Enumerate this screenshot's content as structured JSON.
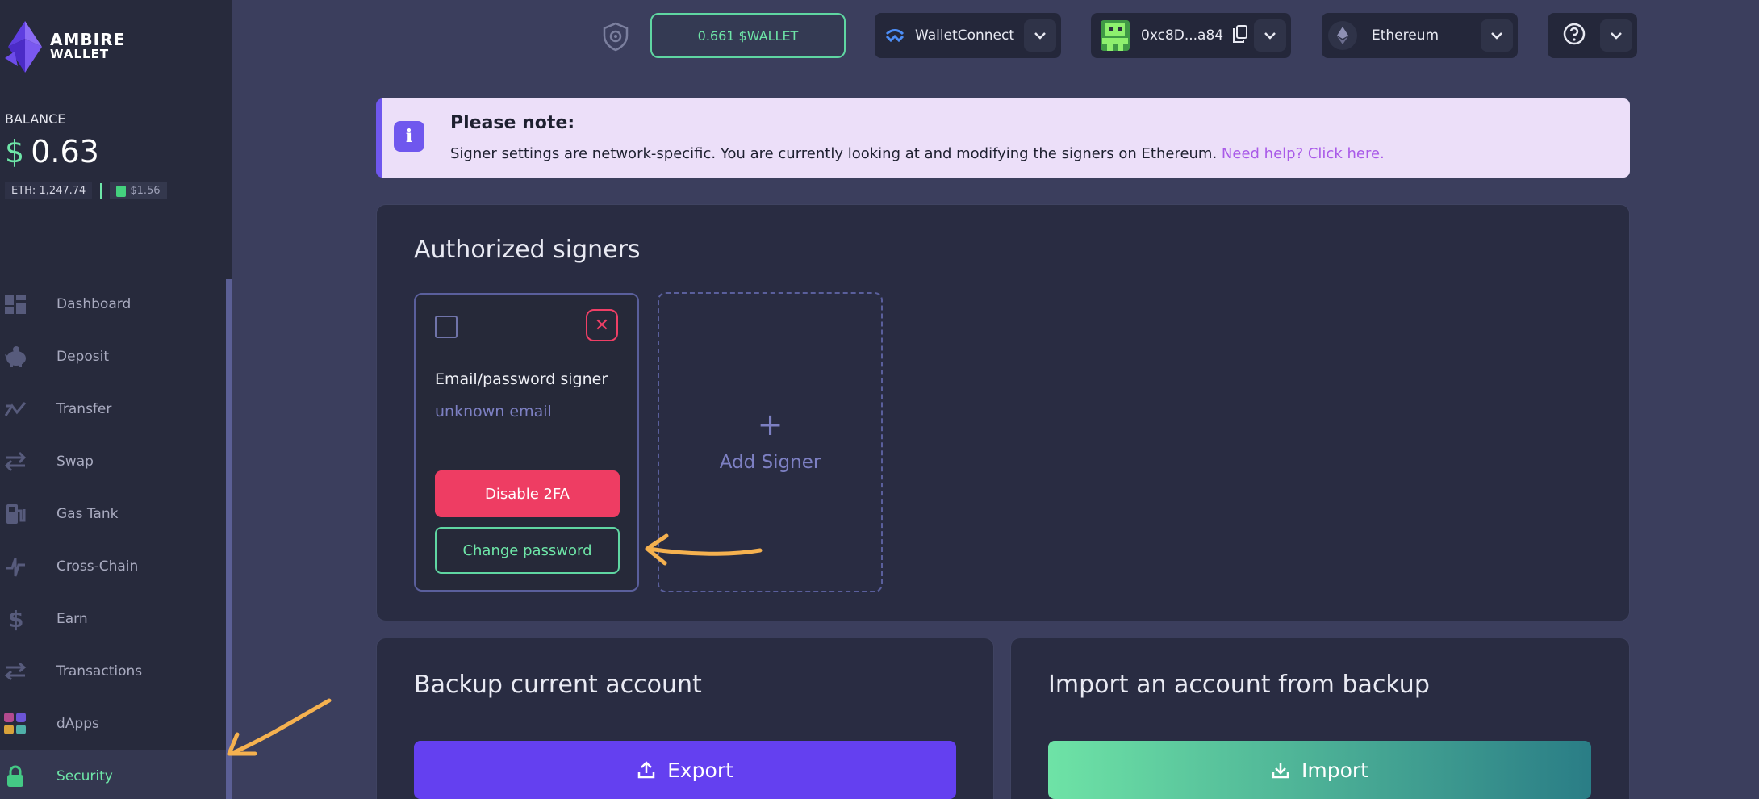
{
  "sidebar": {
    "logo": {
      "line1": "AMBIRE",
      "line2": "WALLET"
    },
    "balance_label": "BALANCE",
    "balance_currency": "$",
    "balance_value": "0.63",
    "eth_chip": "ETH: 1,247.74",
    "gas_chip": "$1.56",
    "items": [
      {
        "label": "Dashboard",
        "icon": "dashboard-icon"
      },
      {
        "label": "Deposit",
        "icon": "piggy-bank-icon"
      },
      {
        "label": "Transfer",
        "icon": "transfer-icon"
      },
      {
        "label": "Swap",
        "icon": "swap-icon"
      },
      {
        "label": "Gas Tank",
        "icon": "gas-pump-icon"
      },
      {
        "label": "Cross-Chain",
        "icon": "cross-chain-icon"
      },
      {
        "label": "Earn",
        "icon": "dollar-icon"
      },
      {
        "label": "Transactions",
        "icon": "transactions-icon"
      },
      {
        "label": "dApps",
        "icon": "apps-grid-icon"
      },
      {
        "label": "Security",
        "icon": "lock-icon",
        "active": true
      }
    ]
  },
  "topbar": {
    "wallet_token": "0.661 $WALLET",
    "walletconnect_label": "WalletConnect",
    "account_address": "0xc8D...a84",
    "network_label": "Ethereum",
    "help_icon": "help-circle-icon"
  },
  "notice": {
    "title": "Please note:",
    "text": "Signer settings are network-specific. You are currently looking at and modifying the signers on Ethereum.",
    "link": "Need help? Click here."
  },
  "signers": {
    "title": "Authorized signers",
    "card": {
      "type": "Email/password signer",
      "email": "unknown email",
      "disable_label": "Disable 2FA",
      "change_label": "Change password"
    },
    "add_label": "Add Signer",
    "add_symbol": "+"
  },
  "backup": {
    "title": "Backup current account",
    "export_label": "Export"
  },
  "import_backup": {
    "title": "Import an account from backup",
    "import_label": "Import"
  },
  "colors": {
    "accent_green": "#6ee6a8",
    "accent_purple": "#6f57ee",
    "danger": "#ee3d63",
    "annotation_arrow": "#f5b14f"
  }
}
